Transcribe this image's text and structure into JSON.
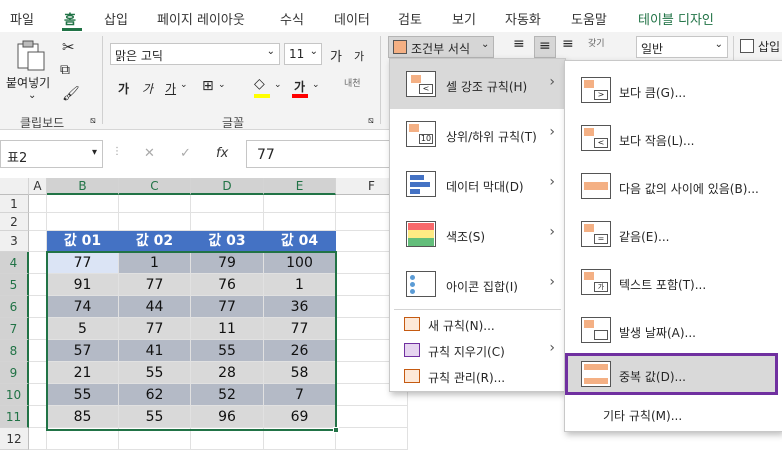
{
  "tabs": [
    "파일",
    "홈",
    "삽입",
    "페이지 레이아웃",
    "수식",
    "데이터",
    "검토",
    "보기",
    "자동화",
    "도움말",
    "테이블 디자인"
  ],
  "ribbon": {
    "clipboard": {
      "paste": "붙여넣기",
      "group": "클립보드"
    },
    "font": {
      "name": "맑은 고딕",
      "size": "11",
      "grow": "가",
      "shrink": "가",
      "bold": "가",
      "italic": "가",
      "underline": "가",
      "fontcolor": "가",
      "group": "글꼴",
      "phonetic": "내천"
    },
    "cond_format": "조건부 서식",
    "number_format": "일반",
    "insert": "삽입",
    "wrap": "갖기"
  },
  "formula_bar": {
    "name_box": "표2",
    "cancel": "✕",
    "enter": "✓",
    "fx": "fx",
    "value": "77"
  },
  "grid": {
    "columns": [
      "A",
      "B",
      "C",
      "D",
      "E",
      "F"
    ],
    "rows": [
      "1",
      "2",
      "3",
      "4",
      "5",
      "6",
      "7",
      "8",
      "9",
      "10",
      "11",
      "12"
    ],
    "headers": [
      "값 01",
      "값 02",
      "값 03",
      "값 04"
    ],
    "data": [
      [
        "77",
        "1",
        "79",
        "100"
      ],
      [
        "91",
        "77",
        "76",
        "1"
      ],
      [
        "74",
        "44",
        "77",
        "36"
      ],
      [
        "5",
        "77",
        "11",
        "77"
      ],
      [
        "57",
        "41",
        "55",
        "26"
      ],
      [
        "21",
        "55",
        "28",
        "58"
      ],
      [
        "55",
        "62",
        "52",
        "7"
      ],
      [
        "85",
        "55",
        "96",
        "69"
      ]
    ]
  },
  "menu1": {
    "items": [
      {
        "label": "셀 강조 규칙(H)",
        "submenu": true,
        "icon": "highlight-cells-icon"
      },
      {
        "label": "상위/하위 규칙(T)",
        "submenu": true,
        "icon": "top-bottom-icon"
      },
      {
        "label": "데이터 막대(D)",
        "submenu": true,
        "icon": "data-bars-icon"
      },
      {
        "label": "색조(S)",
        "submenu": true,
        "icon": "color-scales-icon"
      },
      {
        "label": "아이콘 집합(I)",
        "submenu": true,
        "icon": "icon-sets-icon"
      }
    ],
    "small_items": [
      {
        "label": "새 규칙(N)...",
        "icon": "new-rule-icon"
      },
      {
        "label": "규칙 지우기(C)",
        "icon": "clear-rules-icon",
        "submenu": true
      },
      {
        "label": "규칙 관리(R)...",
        "icon": "manage-rules-icon"
      }
    ]
  },
  "menu2": {
    "items": [
      {
        "label": "보다 큼(G)...",
        "icon": "greater-than-icon"
      },
      {
        "label": "보다 작음(L)...",
        "icon": "less-than-icon"
      },
      {
        "label": "다음 값의 사이에 있음(B)...",
        "icon": "between-icon"
      },
      {
        "label": "같음(E)...",
        "icon": "equal-to-icon"
      },
      {
        "label": "텍스트 포함(T)...",
        "icon": "text-contains-icon"
      },
      {
        "label": "발생 날짜(A)...",
        "icon": "date-occurring-icon"
      },
      {
        "label": "중복 값(D)...",
        "icon": "duplicate-values-icon"
      }
    ],
    "more": "기타 규칙(M)..."
  },
  "colors": {
    "accent": "#217346",
    "header": "#4472c4",
    "highlight_border": "#7030a0"
  }
}
